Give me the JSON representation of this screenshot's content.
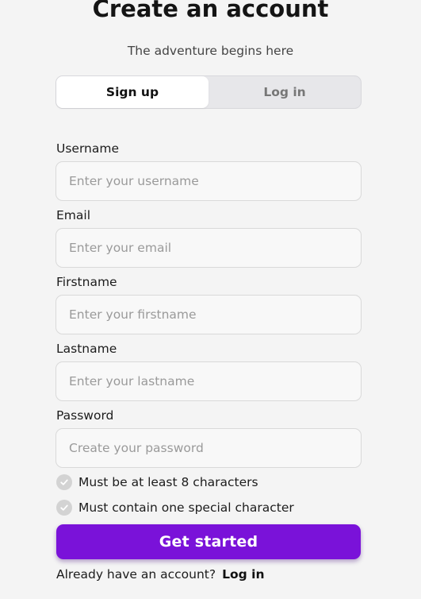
{
  "header": {
    "title": "Create an account",
    "subtitle": "The adventure begins here"
  },
  "tabs": [
    {
      "label": "Sign up",
      "active": true
    },
    {
      "label": "Log in",
      "active": false
    }
  ],
  "fields": {
    "username": {
      "label": "Username",
      "placeholder": "Enter your username",
      "value": ""
    },
    "email": {
      "label": "Email",
      "placeholder": "Enter your email",
      "value": ""
    },
    "firstname": {
      "label": "Firstname",
      "placeholder": "Enter your firstname",
      "value": ""
    },
    "lastname": {
      "label": "Lastname",
      "placeholder": "Enter your lastname",
      "value": ""
    },
    "password": {
      "label": "Password",
      "placeholder": "Create your password",
      "value": ""
    }
  },
  "requirements": [
    {
      "text": "Must be at least 8 characters",
      "icon": "check-circle-icon",
      "met": false
    },
    {
      "text": "Must contain one special character",
      "icon": "check-circle-icon",
      "met": false
    }
  ],
  "cta": {
    "label": "Get started"
  },
  "footer": {
    "prompt": "Already have an account?",
    "link": "Log in"
  },
  "colors": {
    "accent": "#7a12d9",
    "background": "#f4f4f4",
    "check_inactive": "#d3d3d3"
  }
}
